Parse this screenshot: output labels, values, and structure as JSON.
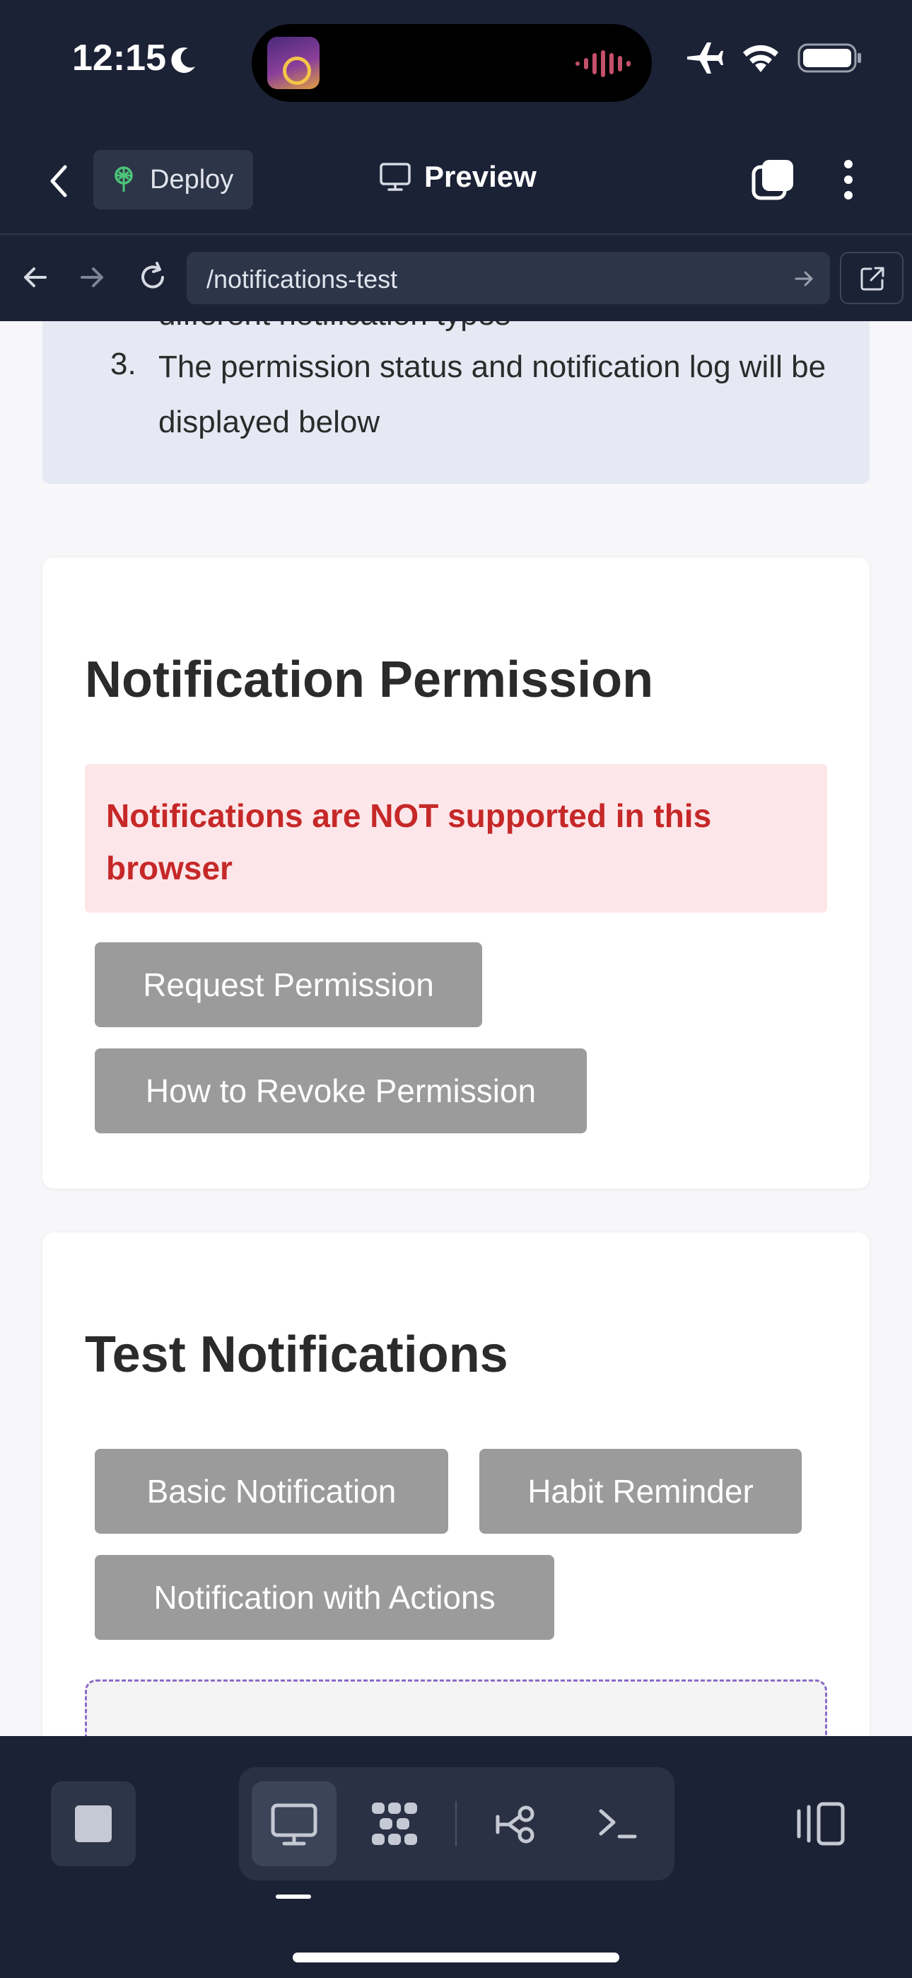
{
  "status_bar": {
    "time": "12:15",
    "icons": [
      "moon-icon",
      "airplane-icon",
      "wifi-icon",
      "battery-icon"
    ]
  },
  "header": {
    "deploy_label": "Deploy",
    "title": "Preview"
  },
  "url_bar": {
    "url": "/notifications-test"
  },
  "instructions": {
    "partial_line": "different notification types",
    "item_number": "3.",
    "item_text": "The permission status and notification log will be displayed below"
  },
  "permission_card": {
    "title": "Notification Permission",
    "alert": "Notifications are NOT supported in this browser",
    "request_button": "Request Permission",
    "revoke_button": "How to Revoke Permission"
  },
  "test_card": {
    "title": "Test Notifications",
    "basic_button": "Basic Notification",
    "habit_button": "Habit Reminder",
    "actions_button": "Notification with Actions"
  },
  "colors": {
    "header_bg": "#1c2235",
    "alert_bg": "#fde6e9",
    "alert_text": "#c62828",
    "button_bg": "#9b9b9b",
    "dashed_border": "#8a6cc8"
  }
}
